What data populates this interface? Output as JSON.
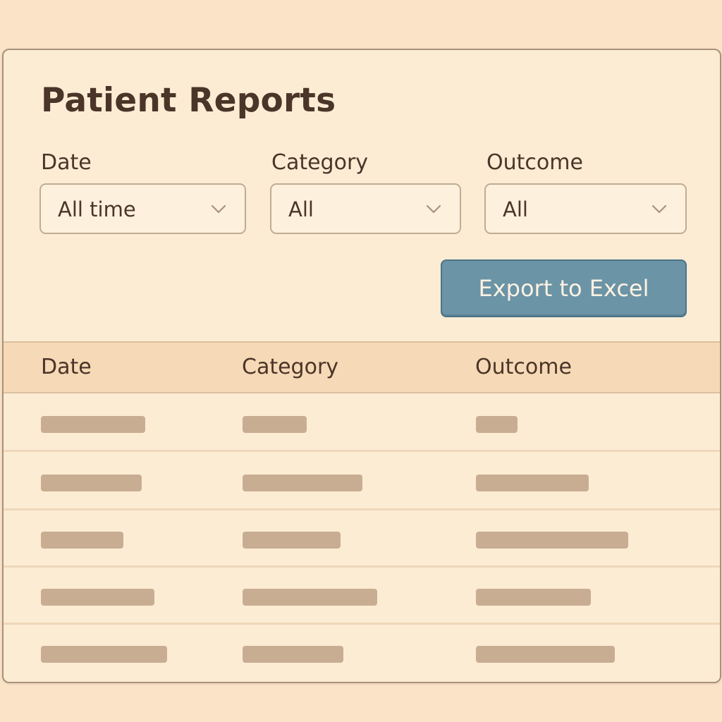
{
  "page": {
    "title": "Patient Reports"
  },
  "filters": [
    {
      "label": "Date",
      "value": "All time"
    },
    {
      "label": "Category",
      "value": "All"
    },
    {
      "label": "Outcome",
      "value": "All"
    }
  ],
  "actions": {
    "export_label": "Export to Excel"
  },
  "table": {
    "columns": [
      "Date",
      "Category",
      "Outcome"
    ],
    "row_count": 5
  },
  "icons": {
    "dropdown": "chevron-down-icon"
  },
  "colors": {
    "background": "#fae3c6",
    "panel": "#fcecd4",
    "header_row": "#f6d9b6",
    "accent_button": "#6b94a6",
    "placeholder_bar": "#c9ad92",
    "text": "#4a3528"
  }
}
